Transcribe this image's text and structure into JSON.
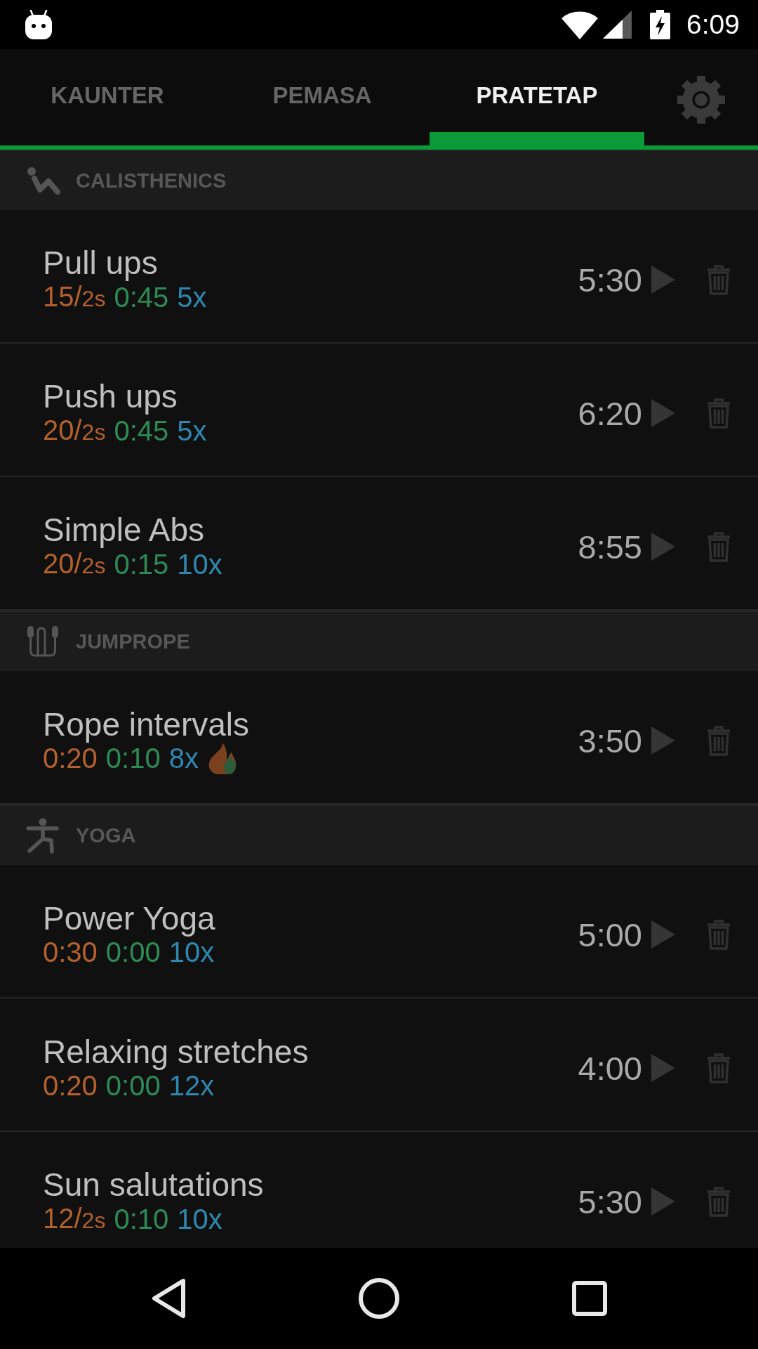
{
  "status_bar": {
    "time": "6:09"
  },
  "tabs": [
    {
      "label": "KAUNTER",
      "selected": false
    },
    {
      "label": "PEMASA",
      "selected": false
    },
    {
      "label": "PRATETAP",
      "selected": true
    }
  ],
  "categories": [
    {
      "kind": "calisthenics",
      "name": "CALISTHENICS",
      "workouts": [
        {
          "name": "Pull ups",
          "work": "15/",
          "pace": "2s",
          "rest": "0:45",
          "rounds": "5x",
          "flame": false,
          "duration": "5:30"
        },
        {
          "name": "Push ups",
          "work": "20/",
          "pace": "2s",
          "rest": "0:45",
          "rounds": "5x",
          "flame": false,
          "duration": "6:20"
        },
        {
          "name": "Simple Abs",
          "work": "20/",
          "pace": "2s",
          "rest": "0:15",
          "rounds": "10x",
          "flame": false,
          "duration": "8:55"
        }
      ]
    },
    {
      "kind": "jumprope",
      "name": "JUMPROPE",
      "workouts": [
        {
          "name": "Rope intervals",
          "work": "0:20",
          "rest": "0:10",
          "rounds": "8x",
          "flame": true,
          "duration": "3:50"
        }
      ]
    },
    {
      "kind": "yoga",
      "name": "YOGA",
      "workouts": [
        {
          "name": "Power Yoga",
          "work": "0:30",
          "rest": "0:00",
          "rounds": "10x",
          "flame": false,
          "duration": "5:00"
        },
        {
          "name": "Relaxing stretches",
          "work": "0:20",
          "rest": "0:00",
          "rounds": "12x",
          "flame": false,
          "duration": "4:00"
        },
        {
          "name": "Sun salutations",
          "work": "12/",
          "pace": "2s",
          "rest": "0:10",
          "rounds": "10x",
          "flame": false,
          "duration": "5:30"
        }
      ]
    }
  ]
}
